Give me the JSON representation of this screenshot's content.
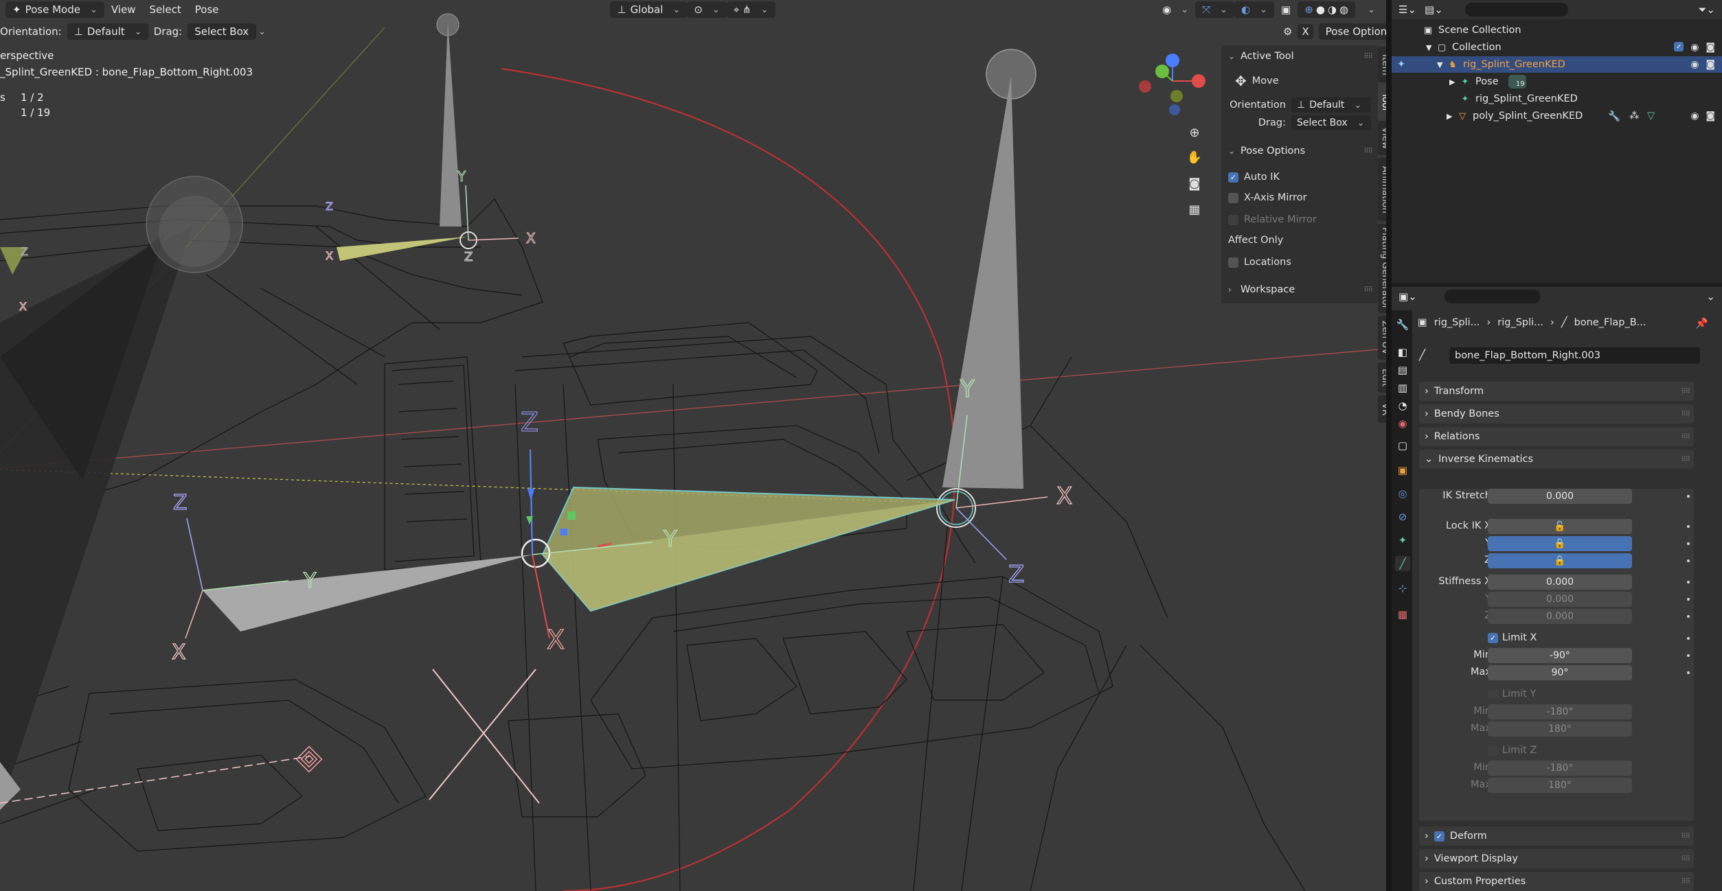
{
  "header": {
    "mode": "Pose Mode",
    "menus": [
      "View",
      "Select",
      "Pose"
    ],
    "transform_orientation": "Global",
    "x_button": "X",
    "pose_options": "Pose Options"
  },
  "tool_settings": {
    "orientation_label": "Orientation:",
    "orientation_value": "Default",
    "drag_label": "Drag:",
    "drag_value": "Select Box"
  },
  "viewport_info": {
    "view_name": "erspective",
    "active": "_Splint_GreenKED : bone_Flap_Bottom_Right.003",
    "objects_label": "s",
    "objects_value": "1 / 2",
    "bones_value": "1 / 19"
  },
  "axis_labels": {
    "x": "X",
    "y": "Y",
    "z": "Z"
  },
  "npanel": {
    "active_tool": {
      "title": "Active Tool",
      "tool": "Move",
      "orientation_label": "Orientation",
      "orientation_value": "Default",
      "drag_label": "Drag:",
      "drag_value": "Select Box"
    },
    "pose_options": {
      "title": "Pose Options",
      "auto_ik": "Auto IK",
      "auto_ik_checked": true,
      "x_axis_mirror": "X-Axis Mirror",
      "relative_mirror": "Relative Mirror",
      "affect_only": "Affect Only",
      "locations": "Locations"
    },
    "workspace": "Workspace"
  },
  "side_tabs": [
    "Item",
    "Tool",
    "View",
    "Animation",
    "Plating Generator",
    "Zen UV",
    "Edit",
    "VR"
  ],
  "outliner": {
    "rows": [
      {
        "label": "Scene Collection",
        "indent": 0
      },
      {
        "label": "Collection",
        "indent": 1
      },
      {
        "label": "rig_Splint_GreenKED",
        "indent": 2
      },
      {
        "label": "Pose",
        "indent": 3,
        "badge": "19"
      },
      {
        "label": "rig_Splint_GreenKED",
        "indent": 3
      },
      {
        "label": "poly_Splint_GreenKED",
        "indent": 2
      }
    ]
  },
  "properties": {
    "breadcrumb": [
      "rig_Spli...",
      "rig_Spli...",
      "bone_Flap_B..."
    ],
    "bone_name": "bone_Flap_Bottom_Right.003",
    "panels": {
      "transform": "Transform",
      "bendy_bones": "Bendy Bones",
      "relations": "Relations",
      "inverse_kinematics": "Inverse Kinematics",
      "deform": "Deform",
      "viewport_display": "Viewport Display",
      "custom_properties": "Custom Properties"
    },
    "ik": {
      "ik_stretch_label": "IK Stretch",
      "ik_stretch": "0.000",
      "lock_ik_x_label": "Lock IK X",
      "lock_y_label": "Y",
      "lock_z_label": "Z",
      "lock_x": false,
      "lock_y": true,
      "lock_z": true,
      "stiffness_x_label": "Stiffness X",
      "stiffness_y_label": "Y",
      "stiffness_z_label": "Z",
      "stiffness_x": "0.000",
      "stiffness_y": "0.000",
      "stiffness_z": "0.000",
      "limit_x": "Limit X",
      "limit_x_checked": true,
      "limit_x_min": "-90°",
      "limit_x_max": "90°",
      "limit_y": "Limit Y",
      "limit_y_min": "-180°",
      "limit_y_max": "180°",
      "limit_z": "Limit Z",
      "limit_z_min": "-180°",
      "limit_z_max": "180°",
      "min_label": "Min",
      "max_label": "Max"
    },
    "deform_checked": true
  },
  "colors": {
    "viewport_bg": "#3a3a3a",
    "selection_blue": "#4772b3",
    "outliner_selected": "#334d80",
    "active_object_text": "#f0a040",
    "bone_selected": "#c8d47a"
  }
}
